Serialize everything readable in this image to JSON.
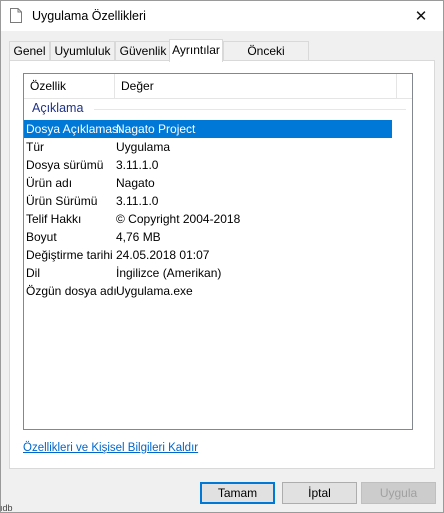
{
  "window": {
    "title": "Uygulama Özellikleri",
    "close_glyph": "✕"
  },
  "tabs": [
    {
      "label": "Genel"
    },
    {
      "label": "Uyumluluk"
    },
    {
      "label": "Güvenlik"
    },
    {
      "label": "Ayrıntılar",
      "active": true
    },
    {
      "label": "Önceki Sürümler"
    }
  ],
  "details": {
    "header_property": "Özellik",
    "header_value": "Değer",
    "group_label": "Açıklama",
    "rows": [
      {
        "key": "Dosya Açıklaması",
        "value": "Nagato Project",
        "selected": true
      },
      {
        "key": "Tür",
        "value": "Uygulama"
      },
      {
        "key": "Dosya sürümü",
        "value": "3.11.1.0"
      },
      {
        "key": "Ürün adı",
        "value": "Nagato"
      },
      {
        "key": "Ürün Sürümü",
        "value": "3.11.1.0"
      },
      {
        "key": "Telif Hakkı",
        "value": "© Copyright 2004-2018"
      },
      {
        "key": "Boyut",
        "value": "4,76 MB"
      },
      {
        "key": "Değiştirme tarihi",
        "value": "24.05.2018 01:07"
      },
      {
        "key": "Dil",
        "value": "İngilizce (Amerikan)"
      },
      {
        "key": "Özgün dosya adı",
        "value": "Uygulama.exe"
      }
    ]
  },
  "remove_link": "Özellikleri ve Kişisel Bilgileri Kaldır",
  "buttons": {
    "ok": "Tamam",
    "cancel": "İptal",
    "apply": "Uygula"
  },
  "colors": {
    "selection": "#0078d7",
    "group_text": "#1e3287",
    "link": "#0066cc"
  },
  "footer_fragment": "ıdb"
}
